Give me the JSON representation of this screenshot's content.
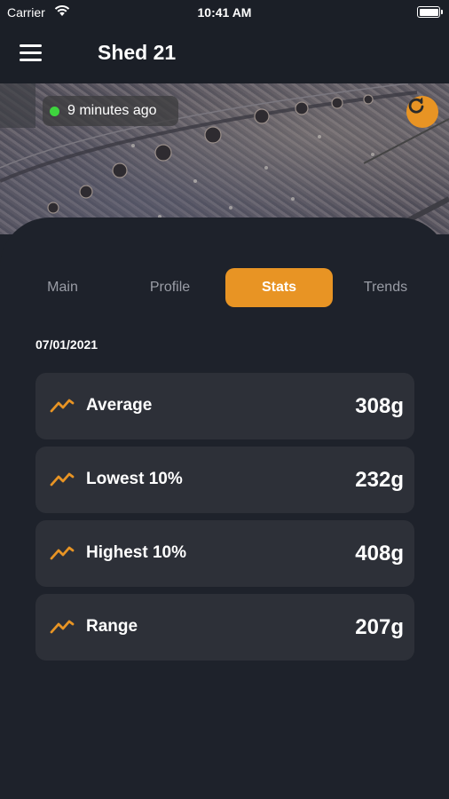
{
  "status_bar": {
    "carrier": "Carrier",
    "time": "10:41 AM",
    "battery_percent": 100
  },
  "header": {
    "title": "Shed 21",
    "menu_icon": "hamburger-menu-icon"
  },
  "camera": {
    "last_updated": "9 minutes ago",
    "status_color": "#3ed43e",
    "refresh_icon": "refresh-icon"
  },
  "tabs": [
    {
      "label": "Main",
      "active": false
    },
    {
      "label": "Profile",
      "active": false
    },
    {
      "label": "Stats",
      "active": true
    },
    {
      "label": "Trends",
      "active": false
    }
  ],
  "stats": {
    "date": "07/01/2021",
    "rows": [
      {
        "icon": "trend-line-icon",
        "label": "Average",
        "value": "308g"
      },
      {
        "icon": "trend-line-icon",
        "label": "Lowest 10%",
        "value": "232g"
      },
      {
        "icon": "trend-line-icon",
        "label": "Highest 10%",
        "value": "408g"
      },
      {
        "icon": "trend-line-icon",
        "label": "Range",
        "value": "207g"
      }
    ]
  },
  "colors": {
    "accent": "#e89424",
    "background": "#1e222b",
    "card": "#2d3038",
    "online": "#3ed43e"
  }
}
